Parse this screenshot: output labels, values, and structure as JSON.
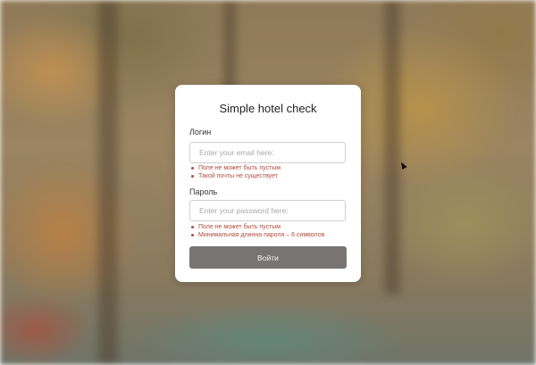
{
  "form": {
    "title": "Simple hotel check",
    "login_label": "Логин",
    "login_placeholder": "Enter your email here:",
    "login_value": "",
    "login_errors": [
      "Поле не может быть пустым",
      "Такой почты не существует"
    ],
    "password_label": "Пароль",
    "password_placeholder": "Enter your password here:",
    "password_value": "",
    "password_errors": [
      "Поле не может быть пустым",
      "Минимальная длинна пароля – 6 символов"
    ],
    "submit_label": "Войти"
  },
  "colors": {
    "error": "#b24b3a",
    "button": "#787474",
    "card": "#ffffff"
  }
}
